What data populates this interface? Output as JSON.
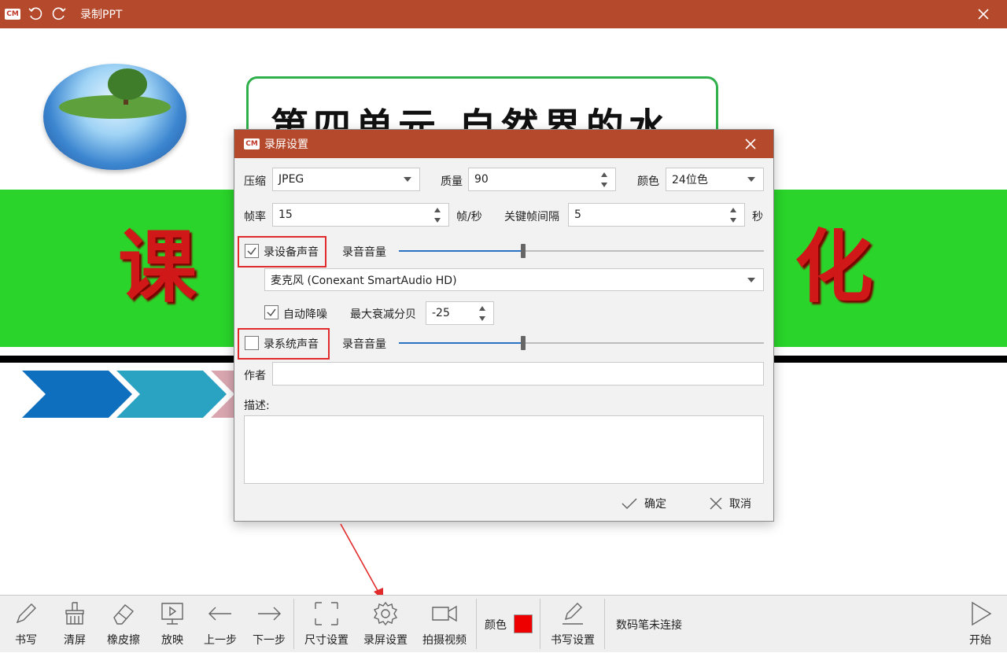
{
  "window": {
    "title": "录制PPT"
  },
  "slide": {
    "title": "第四单元  自然界的水",
    "banner_left": "课",
    "banner_right": "化"
  },
  "dialog": {
    "title": "录屏设置",
    "compress_label": "压缩",
    "compress_value": "JPEG",
    "quality_label": "质量",
    "quality_value": "90",
    "color_label": "颜色",
    "color_value": "24位色",
    "framerate_label": "帧率",
    "framerate_value": "15",
    "framerate_unit": "帧/秒",
    "keyframe_label": "关键帧间隔",
    "keyframe_value": "5",
    "keyframe_unit": "秒",
    "record_device_label": "录设备声音",
    "record_device_checked": true,
    "device_volume_label": "录音音量",
    "device_volume_level": 0.34,
    "mic_device": "麦克风 (Conexant SmartAudio HD)",
    "auto_noise_label": "自动降噪",
    "auto_noise_checked": true,
    "max_atten_label": "最大衰减分贝",
    "max_atten_value": "-25",
    "record_system_label": "录系统声音",
    "record_system_checked": false,
    "system_volume_label": "录音音量",
    "system_volume_level": 0.34,
    "author_label": "作者",
    "author_value": "",
    "desc_label": "描述:",
    "desc_value": "",
    "ok_label": "确定",
    "cancel_label": "取消"
  },
  "toolbar": {
    "write": "书写",
    "clear": "清屏",
    "eraser": "橡皮擦",
    "play": "放映",
    "prev": "上一步",
    "next": "下一步",
    "size_settings": "尺寸设置",
    "record_settings": "录屏设置",
    "capture_video": "拍摄视频",
    "color_label": "颜色",
    "color_value": "#ee0000",
    "write_settings": "书写设置",
    "pen_status": "数码笔未连接",
    "start": "开始"
  },
  "colors": {
    "accent": "#b5492c",
    "band": "#2ad42a",
    "banner_text": "#d01818",
    "annotation": "#e12b2b"
  }
}
